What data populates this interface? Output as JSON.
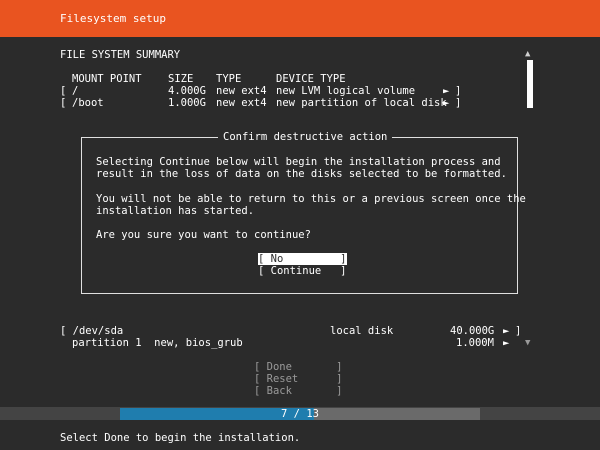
{
  "header": {
    "title": "Filesystem setup"
  },
  "summary": {
    "title": "FILE SYSTEM SUMMARY",
    "columns": {
      "mount_point": "MOUNT POINT",
      "size": "SIZE",
      "type": "TYPE",
      "device_type": "DEVICE TYPE"
    },
    "rows": [
      {
        "bracket_open": "[",
        "mount": "/",
        "size": "4.000G",
        "type": "new ext4",
        "device_type": "new LVM logical volume",
        "arrow": "►",
        "bracket_close": "]"
      },
      {
        "bracket_open": "[",
        "mount": "/boot",
        "size": "1.000G",
        "type": "new ext4",
        "device_type": "new partition of local disk",
        "arrow": "►",
        "bracket_close": "]"
      }
    ]
  },
  "scrollbar": {
    "up_arrow": "▲",
    "down_arrow": "▼"
  },
  "dialog": {
    "title": "Confirm destructive action",
    "lines": [
      "Selecting Continue below will begin the installation process and",
      "result in the loss of data on the disks selected to be formatted.",
      "You will not be able to return to this or a previous screen once the",
      "installation has started.",
      "Are you sure you want to continue?"
    ],
    "buttons": {
      "no": "[ No         ]",
      "continue": "[ Continue   ]"
    }
  },
  "devices": {
    "disk": {
      "label": "[ /dev/sda",
      "kind": "local disk",
      "size": "40.000G",
      "arrow": "►",
      "bracket_close": "]"
    },
    "partition": {
      "label": "partition 1  new, bios_grub",
      "size": "1.000M",
      "arrow": "►"
    }
  },
  "actions": {
    "done": "[ Done       ]",
    "reset": "[ Reset      ]",
    "back": "[ Back       ]"
  },
  "progress": {
    "text": "7 / 13",
    "fraction": 0.5385
  },
  "status": {
    "text": "Select Done to begin the installation."
  },
  "colors": {
    "accent": "#e95420",
    "background": "#2b2b2b",
    "progress": "#1f7dae"
  }
}
